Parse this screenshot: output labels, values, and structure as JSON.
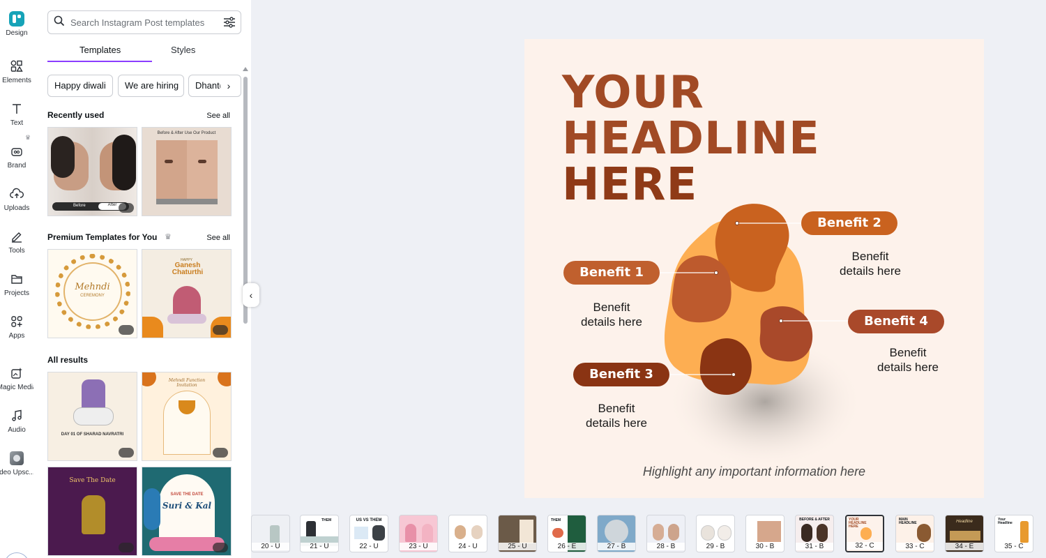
{
  "rail": {
    "items": [
      {
        "label": "Design",
        "icon": "design-icon"
      },
      {
        "label": "Elements",
        "icon": "elements-icon"
      },
      {
        "label": "Text",
        "icon": "text-icon"
      },
      {
        "label": "Brand",
        "icon": "brand-icon"
      },
      {
        "label": "Uploads",
        "icon": "upload-icon"
      },
      {
        "label": "Tools",
        "icon": "pen-icon"
      },
      {
        "label": "Projects",
        "icon": "folder-icon"
      },
      {
        "label": "Apps",
        "icon": "apps-icon"
      },
      {
        "label": "Magic Media",
        "icon": "magic-icon"
      },
      {
        "label": "Audio",
        "icon": "music-icon"
      },
      {
        "label": "Video Upsc...",
        "icon": "video-icon"
      }
    ]
  },
  "panel": {
    "search_placeholder": "Search Instagram Post templates",
    "tabs": {
      "templates": "Templates",
      "styles": "Styles"
    },
    "chips": [
      "Happy diwali",
      "We are hiring",
      "Dhanteras"
    ],
    "recently_used": {
      "title": "Recently used",
      "see_all": "See all"
    },
    "premium": {
      "title": "Premium Templates for You",
      "see_all": "See all"
    },
    "all_results": {
      "title": "All results"
    },
    "thumb_text": {
      "before": "Before",
      "after": "After",
      "before_after_title": "Before & After Use Our Product",
      "mehndi": "Mehndi",
      "ceremony": "CEREMONY",
      "happy": "HAPPY",
      "ganesh": "Ganesh Chaturthi",
      "navratri": "DAY 01 OF SHARAD NAVRATRI",
      "mehndi_invite": "Mehndi Function Invitation",
      "save_date": "Save The Date",
      "save_the_date_caps": "SAVE THE DATE",
      "couple": "Suri & Kal"
    }
  },
  "canvas": {
    "headline": [
      "YOUR",
      "HEADLINE",
      "HERE"
    ],
    "benefits": [
      {
        "label": "Benefit 1",
        "details": [
          "Benefit",
          "details here"
        ],
        "color": "#c0602e"
      },
      {
        "label": "Benefit 2",
        "details": [
          "Benefit",
          "details here"
        ],
        "color": "#c9621f"
      },
      {
        "label": "Benefit 3",
        "details": [
          "Benefit",
          "details here"
        ],
        "color": "#8a3413"
      },
      {
        "label": "Benefit 4",
        "details": [
          "Benefit",
          "details here"
        ],
        "color": "#a9492a"
      }
    ],
    "footer_note": "Highlight any important information here",
    "background": "#fdf2eb"
  },
  "pages": [
    {
      "label": "20 - U"
    },
    {
      "label": "21 - U"
    },
    {
      "label": "22 - U"
    },
    {
      "label": "23 - U"
    },
    {
      "label": "24 - U"
    },
    {
      "label": "25 - U"
    },
    {
      "label": "26 - E"
    },
    {
      "label": "27 - B"
    },
    {
      "label": "28 - B"
    },
    {
      "label": "29 - B"
    },
    {
      "label": "30 - B"
    },
    {
      "label": "31 - B"
    },
    {
      "label": "32 - C"
    },
    {
      "label": "33 - C"
    },
    {
      "label": "34 - E"
    },
    {
      "label": "35 - C"
    }
  ],
  "page_thumb_text": {
    "them": "THEM",
    "us_vs_them": "US VS THEM",
    "before_after": "BEFORE & AFTER",
    "your_headline": "YOUR HEADLINE HERE",
    "main_headline": "MAIN HEADLINE",
    "headline": "Headline",
    "your_headline_short": "Your Headline"
  },
  "colors": {
    "accent": "#8b3dff",
    "brand_teal": "#16a3b8"
  }
}
